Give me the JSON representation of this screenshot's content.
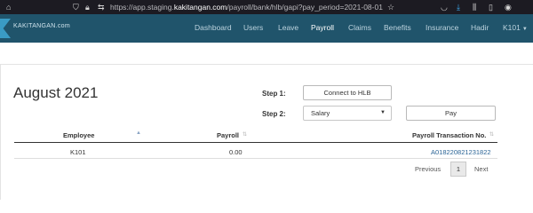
{
  "browser": {
    "url_prefix": "https://app.staging.",
    "url_host": "kakitangan.com",
    "url_path": "/payroll/bank/hlb/gapi?pay_period=2021-08-01",
    "icons": [
      "home-icon",
      "shield-icon",
      "lock-icon",
      "permissions-icon",
      "bookmark-star-icon",
      "pocket-icon",
      "download-icon",
      "library-icon",
      "sidebar-icon",
      "account-icon"
    ]
  },
  "app": {
    "logo_text": "KAKITANGAN.com",
    "nav": [
      {
        "label": "Dashboard"
      },
      {
        "label": "Users"
      },
      {
        "label": "Leave"
      },
      {
        "label": "Payroll",
        "active": true
      },
      {
        "label": "Claims"
      },
      {
        "label": "Benefits"
      },
      {
        "label": "Insurance"
      },
      {
        "label": "Hadir"
      },
      {
        "label": "K101"
      }
    ]
  },
  "page": {
    "title": "August 2021",
    "step1_label": "Step 1:",
    "connect_button": "Connect to HLB",
    "step2_label": "Step 2:",
    "type_select_value": "Salary",
    "pay_button": "Pay"
  },
  "table": {
    "columns": [
      "Employee",
      "Payroll",
      "Payroll Transaction No."
    ],
    "rows": [
      {
        "employee": "K101",
        "payroll": "0.00",
        "transaction_no": "A018220821231822"
      }
    ]
  },
  "pagination": {
    "previous": "Previous",
    "current": "1",
    "next": "Next"
  }
}
